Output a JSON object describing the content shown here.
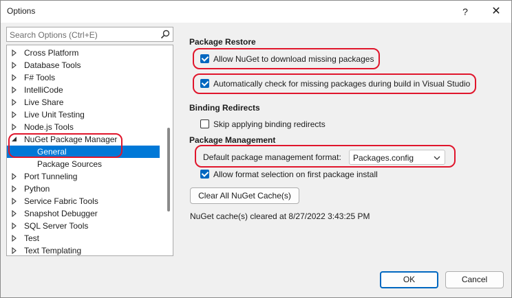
{
  "window": {
    "title": "Options",
    "help_glyph": "?",
    "close_glyph": "✕"
  },
  "search": {
    "placeholder": "Search Options (Ctrl+E)"
  },
  "tree": {
    "items": [
      {
        "label": "Cross Platform",
        "expanded": false,
        "selected": false
      },
      {
        "label": "Database Tools",
        "expanded": false,
        "selected": false
      },
      {
        "label": "F# Tools",
        "expanded": false,
        "selected": false
      },
      {
        "label": "IntelliCode",
        "expanded": false,
        "selected": false
      },
      {
        "label": "Live Share",
        "expanded": false,
        "selected": false
      },
      {
        "label": "Live Unit Testing",
        "expanded": false,
        "selected": false
      },
      {
        "label": "Node.js Tools",
        "expanded": false,
        "selected": false
      },
      {
        "label": "NuGet Package Manager",
        "expanded": true,
        "selected": false
      },
      {
        "label": "General",
        "child": true,
        "selected": true
      },
      {
        "label": "Package Sources",
        "child": true,
        "selected": false
      },
      {
        "label": "Port Tunneling",
        "expanded": false,
        "selected": false
      },
      {
        "label": "Python",
        "expanded": false,
        "selected": false
      },
      {
        "label": "Service Fabric Tools",
        "expanded": false,
        "selected": false
      },
      {
        "label": "Snapshot Debugger",
        "expanded": false,
        "selected": false
      },
      {
        "label": "SQL Server Tools",
        "expanded": false,
        "selected": false
      },
      {
        "label": "Test",
        "expanded": false,
        "selected": false
      },
      {
        "label": "Text Templating",
        "expanded": false,
        "selected": false
      }
    ]
  },
  "package_restore": {
    "heading": "Package Restore",
    "allow_download": {
      "label": "Allow NuGet to download missing packages",
      "checked": true
    },
    "auto_check": {
      "label": "Automatically check for missing packages during build in Visual Studio",
      "checked": true
    }
  },
  "binding_redirects": {
    "heading": "Binding Redirects",
    "skip": {
      "label": "Skip applying binding redirects",
      "checked": false
    }
  },
  "package_management": {
    "heading": "Package Management",
    "format_label": "Default package management format:",
    "format_value": "Packages.config",
    "allow_format": {
      "label": "Allow format selection on first package install",
      "checked": true
    }
  },
  "actions": {
    "clear_cache": "Clear All NuGet Cache(s)",
    "status": "NuGet cache(s) cleared at 8/27/2022 3:43:25 PM",
    "ok": "OK",
    "cancel": "Cancel"
  },
  "colors": {
    "accent": "#0067c0",
    "highlight": "#e0152b",
    "selection": "#0078d7"
  }
}
